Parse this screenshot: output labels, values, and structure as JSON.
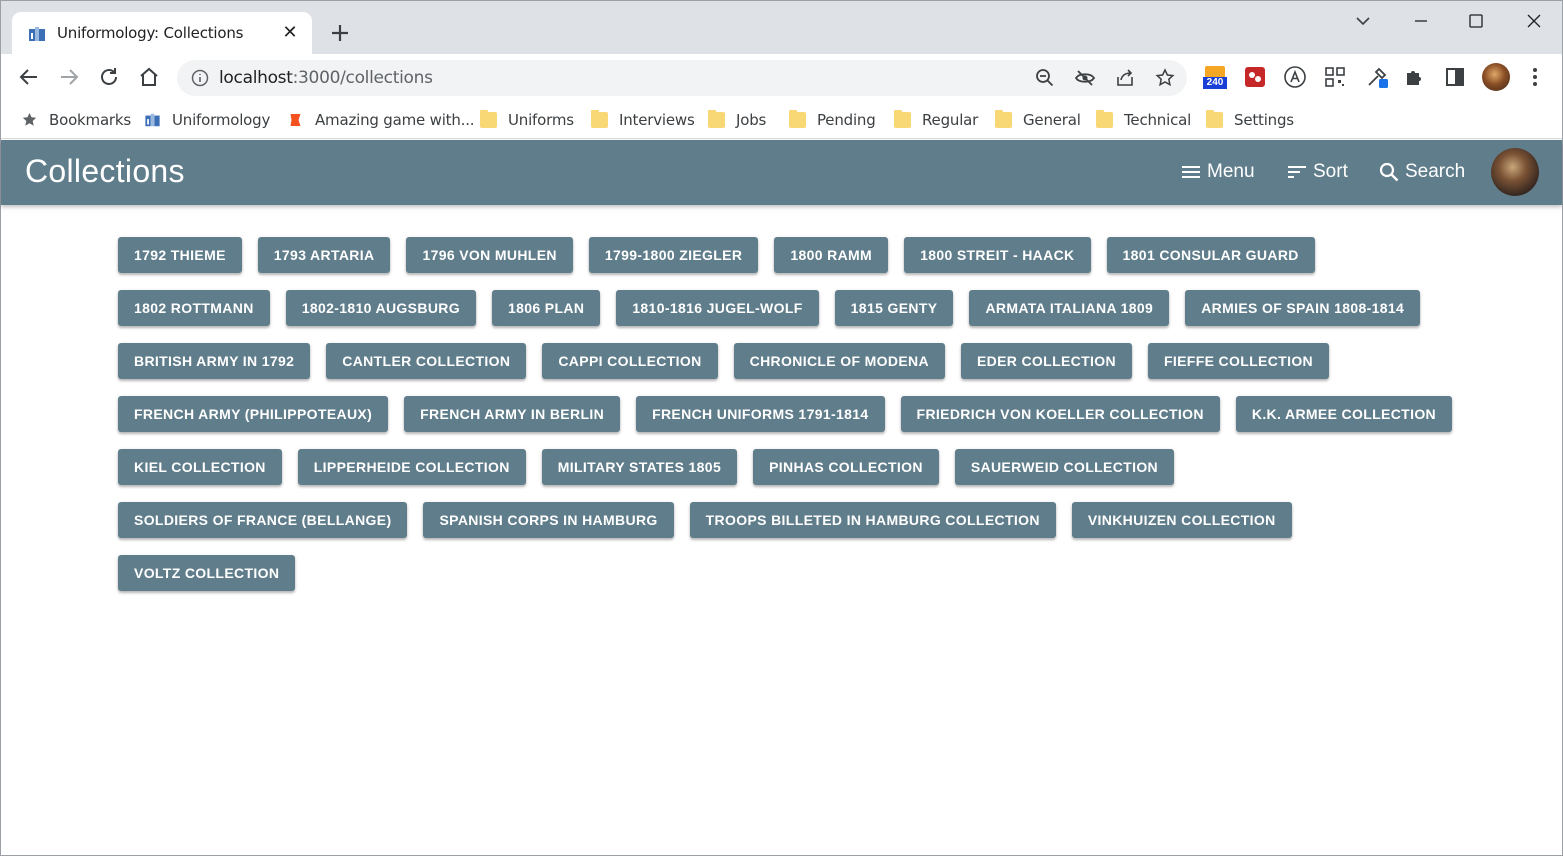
{
  "browser": {
    "tab": {
      "title": "Uniformology: Collections"
    },
    "url": {
      "host": "localhost",
      "path": ":3000/collections"
    },
    "extension_badge": "240"
  },
  "bookmarks": [
    {
      "label": "Bookmarks",
      "icon": "star-icon"
    },
    {
      "label": "Uniformology",
      "icon": "site-favicon"
    },
    {
      "label": "Amazing game with...",
      "icon": "game-favicon"
    },
    {
      "label": "Uniforms",
      "icon": "folder-icon"
    },
    {
      "label": "Interviews",
      "icon": "folder-icon"
    },
    {
      "label": "Jobs",
      "icon": "folder-icon"
    },
    {
      "label": "Pending",
      "icon": "folder-icon"
    },
    {
      "label": "Regular",
      "icon": "folder-icon"
    },
    {
      "label": "General",
      "icon": "folder-icon"
    },
    {
      "label": "Technical",
      "icon": "folder-icon"
    },
    {
      "label": "Settings",
      "icon": "folder-icon"
    }
  ],
  "appbar": {
    "title": "Collections",
    "menu_label": "Menu",
    "sort_label": "Sort",
    "search_label": "Search",
    "color": "#607d8b"
  },
  "collections": [
    "1792 THIEME",
    "1793 ARTARIA",
    "1796 VON MUHLEN",
    "1799-1800 ZIEGLER",
    "1800 RAMM",
    "1800 STREIT - HAACK",
    "1801 CONSULAR GUARD",
    "1802 ROTTMANN",
    "1802-1810 AUGSBURG",
    "1806 PLAN",
    "1810-1816 JUGEL-WOLF",
    "1815 GENTY",
    "ARMATA ITALIANA 1809",
    "ARMIES OF SPAIN 1808-1814",
    "BRITISH ARMY IN 1792",
    "CANTLER COLLECTION",
    "CAPPI COLLECTION",
    "CHRONICLE OF MODENA",
    "EDER COLLECTION",
    "FIEFFE COLLECTION",
    "FRENCH ARMY (PHILIPPOTEAUX)",
    "FRENCH ARMY IN BERLIN",
    "FRENCH UNIFORMS 1791-1814",
    "FRIEDRICH VON KOELLER COLLECTION",
    "K.K. ARMEE COLLECTION",
    "KIEL COLLECTION",
    "LIPPERHEIDE COLLECTION",
    "MILITARY STATES 1805",
    "PINHAS COLLECTION",
    "SAUERWEID COLLECTION",
    "SOLDIERS OF FRANCE (BELLANGE)",
    "SPANISH CORPS IN HAMBURG",
    "TROOPS BILLETED IN HAMBURG COLLECTION",
    "VINKHUIZEN COLLECTION",
    "VOLTZ COLLECTION"
  ]
}
